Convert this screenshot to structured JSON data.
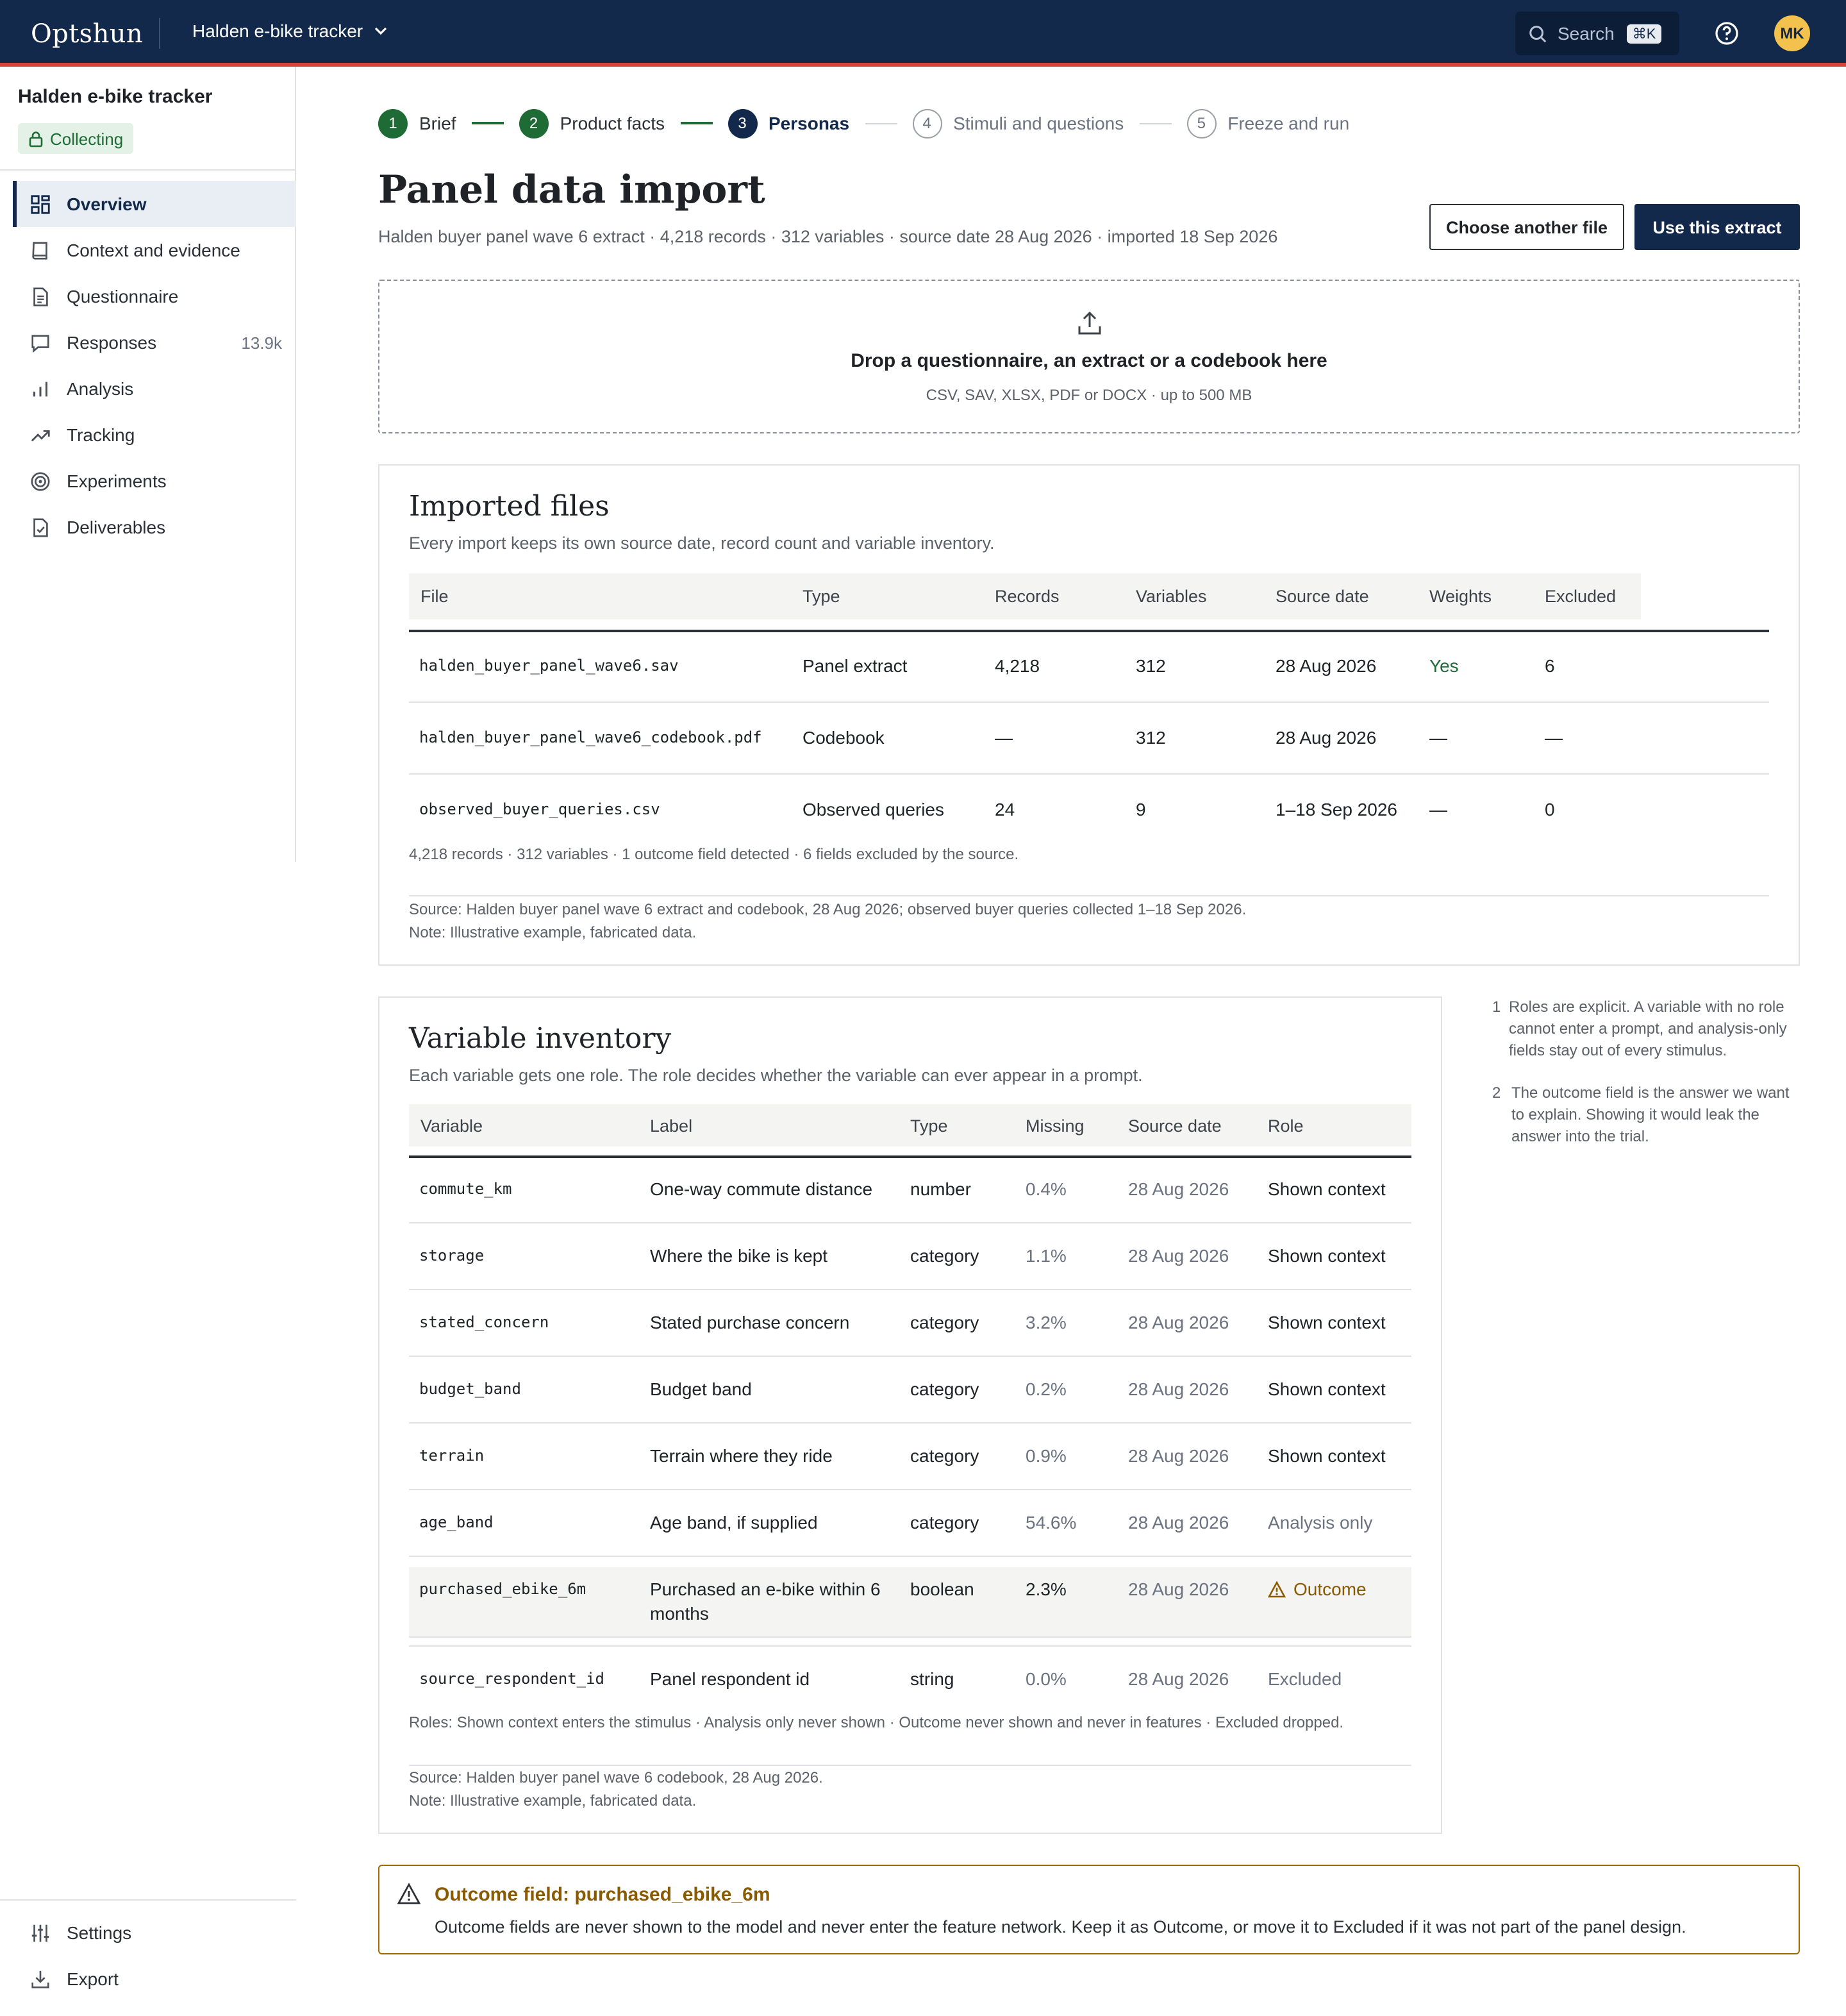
{
  "app": {
    "logo": "Optshun",
    "project_switcher": "Halden e-bike tracker"
  },
  "topbar": {
    "search_label": "Search",
    "search_shortcut": "⌘K",
    "avatar_initials": "MK"
  },
  "sidebar": {
    "project_title": "Halden e-bike tracker",
    "status": "Collecting",
    "items": [
      {
        "label": "Overview",
        "icon": "grid-icon",
        "active": true
      },
      {
        "label": "Context and evidence",
        "icon": "book-icon"
      },
      {
        "label": "Questionnaire",
        "icon": "document-icon"
      },
      {
        "label": "Responses",
        "icon": "chat-icon",
        "count": "13.9k"
      },
      {
        "label": "Analysis",
        "icon": "bar-chart-icon"
      },
      {
        "label": "Tracking",
        "icon": "trend-icon"
      },
      {
        "label": "Experiments",
        "icon": "target-icon"
      },
      {
        "label": "Deliverables",
        "icon": "file-check-icon"
      }
    ],
    "bottom_items": [
      {
        "label": "Settings",
        "icon": "sliders-icon"
      },
      {
        "label": "Export",
        "icon": "download-icon"
      }
    ]
  },
  "stepper": [
    {
      "num": "1",
      "label": "Brief",
      "state": "done"
    },
    {
      "num": "2",
      "label": "Product facts",
      "state": "done"
    },
    {
      "num": "3",
      "label": "Personas",
      "state": "current"
    },
    {
      "num": "4",
      "label": "Stimuli and questions",
      "state": "todo"
    },
    {
      "num": "5",
      "label": "Freeze and run",
      "state": "todo"
    }
  ],
  "header": {
    "title": "Panel data import",
    "subtitle": "Halden buyer panel wave 6 extract · 4,218 records · 312 variables · source date 28 Aug 2026 · imported 18 Sep 2026",
    "btn_choose": "Choose another file",
    "btn_use": "Use this extract"
  },
  "dropzone": {
    "title": "Drop a questionnaire, an extract or a codebook here",
    "subtitle": "CSV, SAV, XLSX, PDF or DOCX · up to 500 MB"
  },
  "imported_files": {
    "title": "Imported files",
    "subtitle": "Every import keeps its own source date, record count and variable inventory.",
    "columns": [
      "File",
      "Type",
      "Records",
      "Variables",
      "Source date",
      "Weights",
      "Excluded"
    ],
    "rows": [
      {
        "file": "halden_buyer_panel_wave6.sav",
        "type": "Panel extract",
        "records": "4,218",
        "variables": "312",
        "source_date": "28 Aug 2026",
        "weights": "Yes",
        "excluded": "6"
      },
      {
        "file": "halden_buyer_panel_wave6_codebook.pdf",
        "type": "Codebook",
        "records": "—",
        "variables": "312",
        "source_date": "28 Aug 2026",
        "weights": "—",
        "excluded": "—"
      },
      {
        "file": "observed_buyer_queries.csv",
        "type": "Observed queries",
        "records": "24",
        "variables": "9",
        "source_date": "1–18 Sep 2026",
        "weights": "—",
        "excluded": "0"
      }
    ],
    "summary": "4,218 records · 312 variables · 1 outcome field detected · 6 fields excluded by the source.",
    "source": "Source: Halden buyer panel wave 6 extract and codebook, 28 Aug 2026; observed buyer queries collected 1–18 Sep 2026.",
    "note": "Note: Illustrative example, fabricated data."
  },
  "variable_inventory": {
    "title": "Variable inventory",
    "subtitle": "Each variable gets one role. The role decides whether the variable can ever appear in a prompt.",
    "columns": [
      "Variable",
      "Label",
      "Type",
      "Missing",
      "Source date",
      "Role"
    ],
    "rows": [
      {
        "variable": "commute_km",
        "label": "One-way commute distance",
        "type": "number",
        "missing": "0.4%",
        "source_date": "28 Aug 2026",
        "role": "Shown context"
      },
      {
        "variable": "storage",
        "label": "Where the bike is kept",
        "type": "category",
        "missing": "1.1%",
        "source_date": "28 Aug 2026",
        "role": "Shown context"
      },
      {
        "variable": "stated_concern",
        "label": "Stated purchase concern",
        "type": "category",
        "missing": "3.2%",
        "source_date": "28 Aug 2026",
        "role": "Shown context"
      },
      {
        "variable": "budget_band",
        "label": "Budget band",
        "type": "category",
        "missing": "0.2%",
        "source_date": "28 Aug 2026",
        "role": "Shown context"
      },
      {
        "variable": "terrain",
        "label": "Terrain where they ride",
        "type": "category",
        "missing": "0.9%",
        "source_date": "28 Aug 2026",
        "role": "Shown context"
      },
      {
        "variable": "age_band",
        "label": "Age band, if supplied",
        "type": "category",
        "missing": "54.6%",
        "source_date": "28 Aug 2026",
        "role": "Analysis only"
      },
      {
        "variable": "purchased_ebike_6m",
        "label_line1": "Purchased an e-bike within 6",
        "label_line2": "months",
        "type": "boolean",
        "missing": "2.3%",
        "source_date": "28 Aug 2026",
        "role": "Outcome"
      },
      {
        "variable": "source_respondent_id",
        "label": "Panel respondent id",
        "type": "string",
        "missing": "0.0%",
        "source_date": "28 Aug 2026",
        "role": "Excluded"
      }
    ],
    "roles_legend": "Roles: Shown context enters the stimulus · Analysis only never shown · Outcome never shown and never in features · Excluded dropped.",
    "source": "Source: Halden buyer panel wave 6 codebook, 28 Aug 2026.",
    "note": "Note: Illustrative example, fabricated data."
  },
  "side_notes": [
    {
      "num": "1",
      "text": "Roles are explicit. A variable with no role cannot enter a prompt, and analysis-only fields stay out of every stimulus."
    },
    {
      "num": "2",
      "text": "The outcome field is the answer we want to explain. Showing it would leak the answer into the trial."
    }
  ],
  "alert": {
    "title": "Outcome field: purchased_ebike_6m",
    "body": "Outcome fields are never shown to the model and never enter the feature network. Keep it as Outcome, or move it to Excluded if it was not part of the panel design."
  },
  "colors": {
    "navy": "#13294b",
    "accent_red": "#d9433b",
    "green": "#1e6b36",
    "warning": "#8a5a00"
  }
}
